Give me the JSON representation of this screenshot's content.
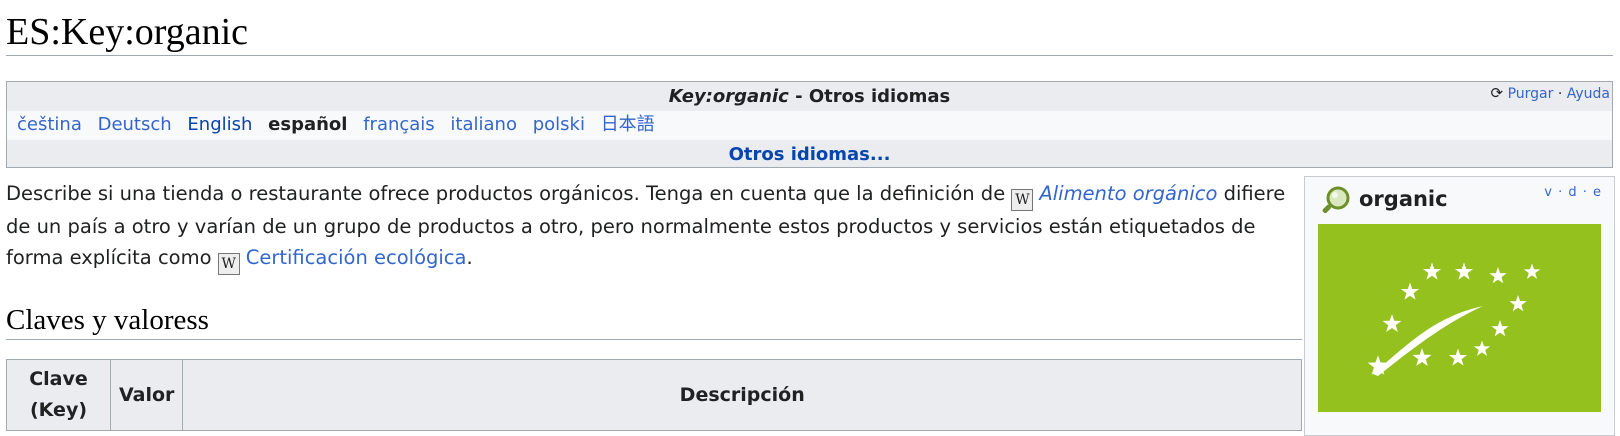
{
  "page": {
    "title": "ES:Key:organic"
  },
  "language_box": {
    "header_key": "Key:organic",
    "header_rest": " - Otros idiomas",
    "purge_label": "Purgar",
    "purge_separator": "·",
    "help_label": "Ayuda",
    "languages": [
      {
        "label": "čeština",
        "state": "link"
      },
      {
        "label": "Deutsch",
        "state": "link"
      },
      {
        "label": "English",
        "state": "visited"
      },
      {
        "label": "español",
        "state": "current"
      },
      {
        "label": "français",
        "state": "link"
      },
      {
        "label": "italiano",
        "state": "link"
      },
      {
        "label": "polski",
        "state": "link"
      },
      {
        "label": "日本語",
        "state": "link"
      }
    ],
    "more_label": "Otros idiomas..."
  },
  "description": {
    "part1": "Describe si una tienda o restaurante ofrece productos orgánicos. Tenga en cuenta que la definición de ",
    "link1": "Alimento orgánico",
    "part2": " difiere de un país a otro y varían de un grupo de productos a otro, pero normalmente estos productos y servicios están etiquetados de forma explícita como ",
    "link2": "Certificación ecológica",
    "part3": ".",
    "wikipedia_icon_glyph": "W"
  },
  "section": {
    "heading": "Claves y valoress"
  },
  "table": {
    "headers": [
      "Clave\n(Key)",
      "Valor",
      "Descripción"
    ]
  },
  "infobox": {
    "title": "organic",
    "vde": "v · d · e",
    "logo_color": "#95c11f"
  },
  "colors": {
    "link": "#3366cc",
    "visited_link": "#0645ad",
    "header_bg": "#eaecf0",
    "border": "#a2a9b1"
  }
}
